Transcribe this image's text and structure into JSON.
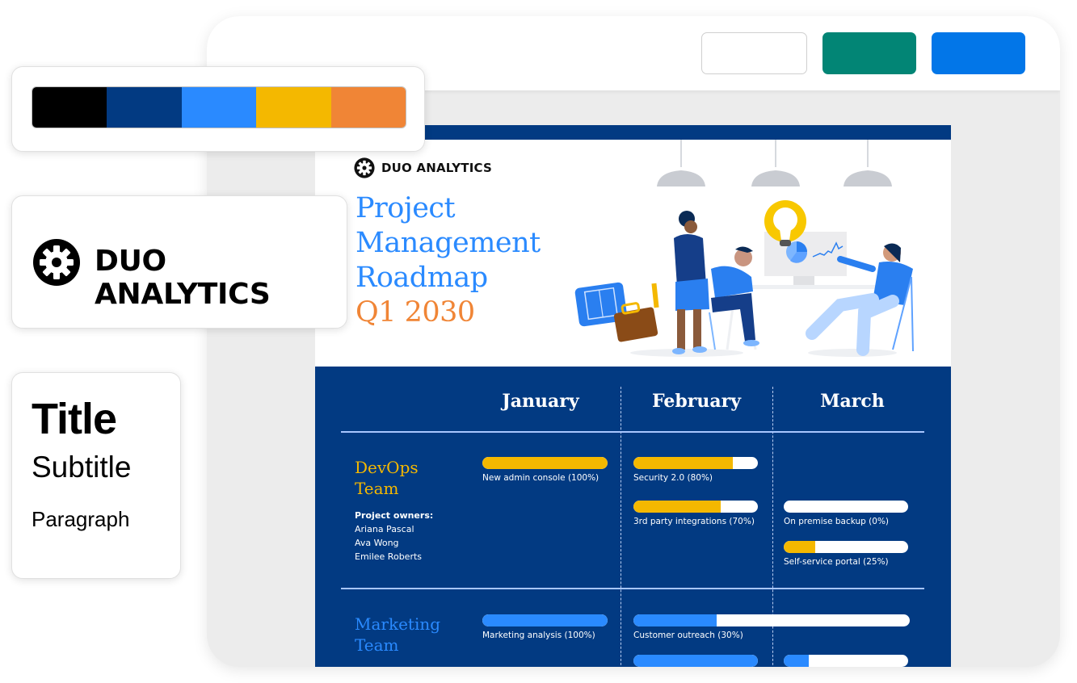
{
  "toolbar": {
    "buttons": [
      {
        "name": "outline-button",
        "color": "#ffffff"
      },
      {
        "name": "teal-button",
        "color": "#028575"
      },
      {
        "name": "blue-button",
        "color": "#0276e8"
      }
    ]
  },
  "palette": {
    "swatches": [
      "#000000",
      "#023a82",
      "#2a8aff",
      "#f4b800",
      "#f08536"
    ]
  },
  "brand": {
    "name": "DUO ANALYTICS",
    "icon": "gear-icon"
  },
  "typography": {
    "title": "Title",
    "subtitle": "Subtitle",
    "paragraph": "Paragraph"
  },
  "document": {
    "brand": "DUO ANALYTICS",
    "title_lines": [
      "Project",
      "Management",
      "Roadmap"
    ],
    "quarter": "Q1 2030",
    "months": [
      "January",
      "February",
      "March"
    ],
    "teams": [
      {
        "name_lines": [
          "DevOps",
          "Team"
        ],
        "owners_label": "Project owners:",
        "owners": [
          "Ariana Pascal",
          "Ava Wong",
          "Emilee Roberts"
        ],
        "color": "#f4b800",
        "tasks": [
          {
            "label": "New admin console (100%)",
            "progress": 100
          },
          {
            "label": "Security 2.0 (80%)",
            "progress": 80
          },
          {
            "label": "3rd party integrations (70%)",
            "progress": 70
          },
          {
            "label": "On premise backup (0%)",
            "progress": 0
          },
          {
            "label": "Self-service portal (25%)",
            "progress": 25
          }
        ]
      },
      {
        "name_lines": [
          "Marketing",
          "Team"
        ],
        "color": "#2a8aff",
        "tasks": [
          {
            "label": "Marketing analysis (100%)",
            "progress": 100
          },
          {
            "label": "Customer outreach (30%)",
            "progress": 30
          },
          {
            "label": "",
            "progress": 100
          },
          {
            "label": "",
            "progress": 20
          }
        ]
      }
    ]
  }
}
